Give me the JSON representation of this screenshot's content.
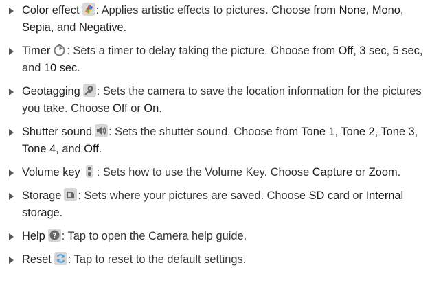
{
  "items": [
    {
      "name": "Color effect",
      "icon": "color-effect-icon",
      "text1": ": Applies artistic effects to pictures. Choose from ",
      "opts": [
        "None",
        "Mono",
        "Sepia",
        "Negative"
      ],
      "seps": [
        ", ",
        ", ",
        ", and ",
        "."
      ]
    },
    {
      "name": "Timer",
      "icon": "timer-icon",
      "text1": ": Sets a timer to delay taking the picture. Choose from ",
      "opts": [
        "Off",
        "3 sec",
        "5 sec",
        "10 sec"
      ],
      "seps": [
        ", ",
        ", ",
        ", and ",
        "."
      ]
    },
    {
      "name": "Geotagging",
      "icon": "geotagging-icon",
      "text1": ": Sets the camera to save the location information for the pictures you take. Choose ",
      "opts": [
        "Off",
        "On"
      ],
      "seps": [
        " or ",
        "."
      ]
    },
    {
      "name": "Shutter sound",
      "icon": "shutter-sound-icon",
      "text1": ": Sets the shutter sound. Choose from ",
      "opts": [
        "Tone 1",
        "Tone 2",
        "Tone 3",
        "Tone 4",
        "Off"
      ],
      "seps": [
        ", ",
        ", ",
        ", ",
        ", and ",
        "."
      ]
    },
    {
      "name": "Volume key",
      "icon": "volume-key-icon",
      "text1": ": Sets how to use the Volume Key. Choose ",
      "opts": [
        "Capture",
        "Zoom"
      ],
      "seps": [
        " or ",
        "."
      ]
    },
    {
      "name": "Storage",
      "icon": "storage-icon",
      "text1": ": Sets where your pictures are saved. Choose ",
      "opts": [
        "SD card",
        "Internal storage"
      ],
      "seps": [
        " or ",
        "."
      ]
    },
    {
      "name": "Help",
      "icon": "help-icon",
      "text1": ": Tap to open the Camera help guide.",
      "opts": [],
      "seps": []
    },
    {
      "name": "Reset",
      "icon": "reset-icon",
      "text1": ": Tap to reset to the default settings.",
      "opts": [],
      "seps": []
    }
  ]
}
